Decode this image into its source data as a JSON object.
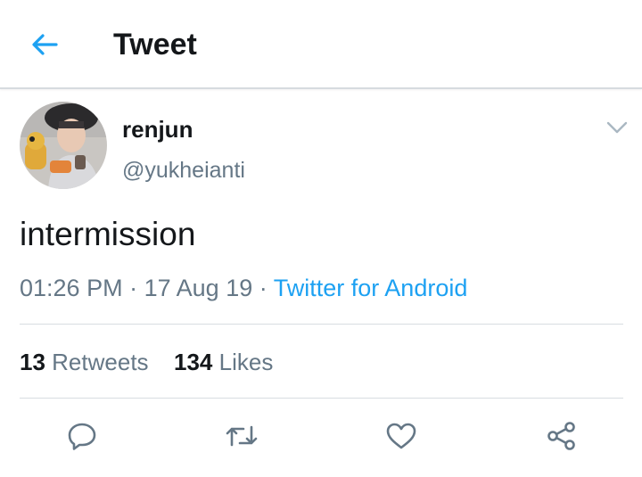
{
  "header": {
    "title": "Tweet",
    "back_icon": "arrow-left-icon",
    "accent_color": "#1da1f2"
  },
  "tweet": {
    "author_name": "renjun",
    "author_handle": "@yukheianti",
    "text": "intermission",
    "time": "01:26 PM",
    "dot1": "·",
    "date": "17 Aug 19",
    "dot2": "·",
    "source": "Twitter for Android"
  },
  "stats": {
    "retweets_count": "13",
    "retweets_label": "Retweets",
    "likes_count": "134",
    "likes_label": "Likes"
  },
  "actions": [
    {
      "icon": "reply-icon"
    },
    {
      "icon": "retweet-icon"
    },
    {
      "icon": "like-icon"
    },
    {
      "icon": "share-icon"
    }
  ]
}
